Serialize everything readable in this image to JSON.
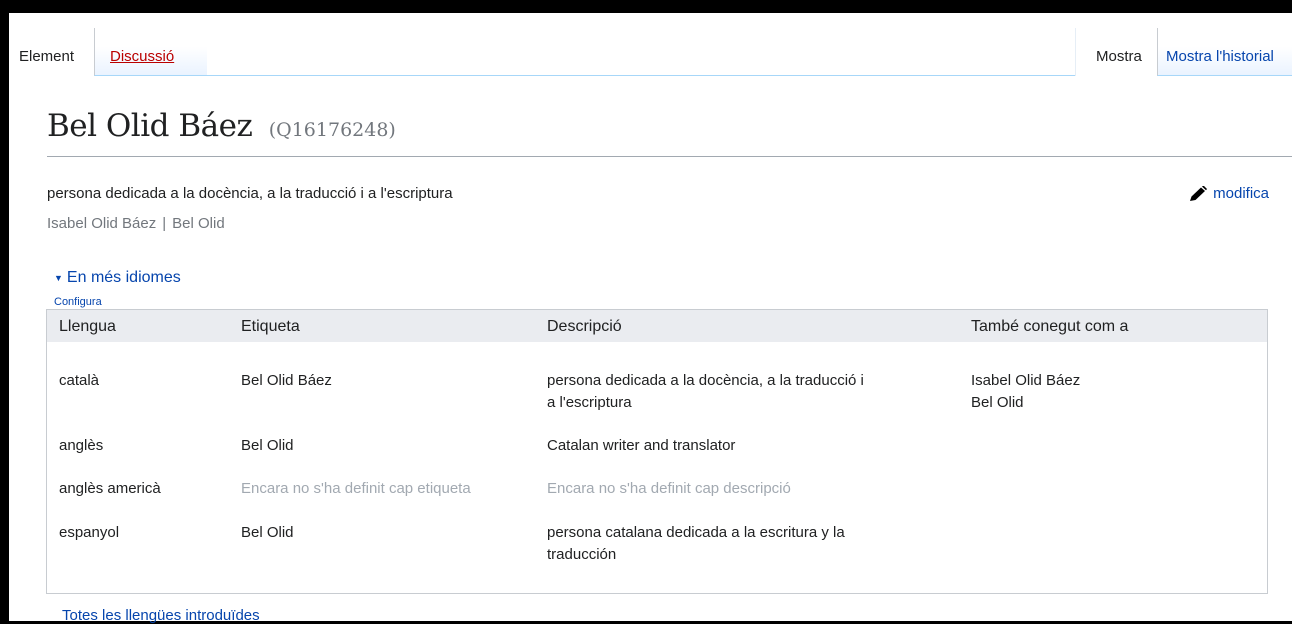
{
  "tabs": {
    "element": "Element",
    "discussio": "Discussió",
    "mostra": "Mostra",
    "historial": "Mostra l'historial"
  },
  "heading": {
    "label": "Bel Olid Báez",
    "qid": "(Q16176248)"
  },
  "description": "persona dedicada a la docència, a la traducció i a l'escriptura",
  "aliases": [
    "Isabel Olid Báez",
    "Bel Olid"
  ],
  "alias_separator": "|",
  "edit_label": "modifica",
  "edit_icon": "pencil-icon",
  "more_languages": {
    "toggle_label": "En més idiomes",
    "configure_label": "Configura",
    "toggle_icon": "triangle-down-icon"
  },
  "table": {
    "headers": [
      "Llengua",
      "Etiqueta",
      "Descripció",
      "També conegut com a"
    ],
    "rows": [
      {
        "language": "català",
        "label": "Bel Olid Báez",
        "description_line1": "persona dedicada a la docència, a la traducció i",
        "description_line2": "a l'escriptura",
        "alias1": "Isabel Olid Báez",
        "alias2": "Bel Olid"
      },
      {
        "language": "anglès",
        "label": "Bel Olid",
        "description_line1": "Catalan writer and translator"
      },
      {
        "language": "anglès americà",
        "label": "Encara no s'ha definit cap etiqueta",
        "description_line1": "Encara no s'ha definit cap descripció"
      },
      {
        "language": "espanyol",
        "label": "Bel Olid",
        "description_line1": "persona catalana dedicada a la escritura y la",
        "description_line2": "traducción"
      }
    ]
  },
  "all_languages_link": "Totes les llengües introduïdes",
  "colors": {
    "link": "#0645ad",
    "new_link": "#ba0000",
    "muted": "#72777d",
    "placeholder": "#a2a9b1",
    "header_bg": "#eaecf0"
  }
}
